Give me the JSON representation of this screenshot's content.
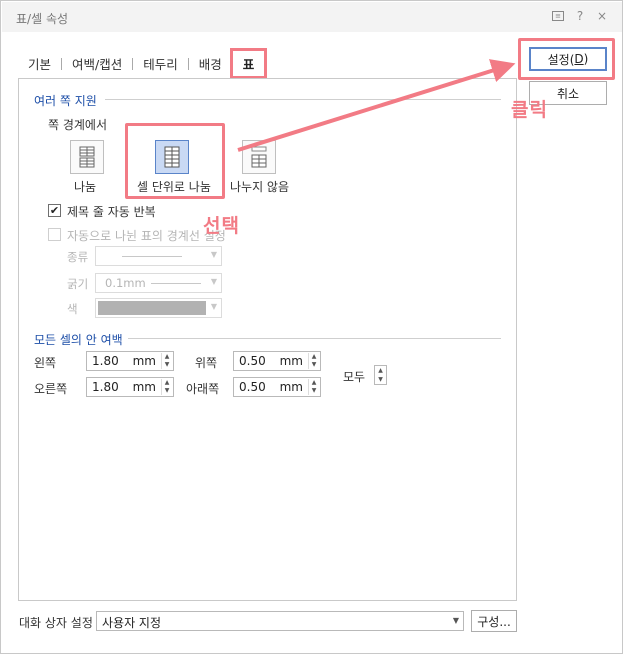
{
  "window": {
    "title": "표/셀 속성"
  },
  "titlebar_icons": [
    "feedback-icon",
    "help-icon",
    "close-icon"
  ],
  "titlebar_glyphs": {
    "help": "?",
    "close": "×"
  },
  "tabs": [
    {
      "label": "기본"
    },
    {
      "label": "여백/캡션"
    },
    {
      "label": "테두리"
    },
    {
      "label": "배경"
    },
    {
      "label": "표",
      "active": true
    }
  ],
  "buttons": {
    "ok_label": "설정(",
    "ok_key": "D",
    "ok_close": ")",
    "cancel_label": "취소"
  },
  "page_split": {
    "section_title": "여러 쪽 지원",
    "boundary_label": "쪽 경계에서",
    "options": [
      {
        "label": "나눔",
        "icon": "split-icon",
        "selected": false
      },
      {
        "label": "셀 단위로 나눔",
        "icon": "split-by-cell-icon",
        "selected": true
      },
      {
        "label": "나누지 않음",
        "icon": "no-split-icon",
        "selected": false
      }
    ],
    "repeat_header": {
      "label": "제목 줄 자동 반복",
      "checked": true,
      "check_glyph": "✔"
    },
    "auto_boundary": {
      "label": "자동으로 나뉜 표의 경계선 설정",
      "checked": false,
      "disabled": true
    },
    "line_type_label": "종류",
    "line_width_label": "굵기",
    "line_width_value": "0.1mm",
    "line_color_label": "색"
  },
  "cell_margin": {
    "section_title": "모든 셀의 안 여백",
    "left_label": "왼쪽",
    "left_value": "1.80",
    "right_label": "오른쪽",
    "right_value": "1.80",
    "top_label": "위쪽",
    "top_value": "0.50",
    "bottom_label": "아래쪽",
    "bottom_value": "0.50",
    "unit": "mm",
    "all_label": "모두"
  },
  "footer": {
    "dialog_setting_label": "대화 상자 설정",
    "dialog_setting_value": "사용자 지정",
    "configure_label": "구성..."
  },
  "annotations": {
    "select": "선택",
    "click": "클릭"
  },
  "colors": {
    "highlight": "#f27b85",
    "selected_bg": "#c9d9f4",
    "accent": "#1e4fa8"
  }
}
